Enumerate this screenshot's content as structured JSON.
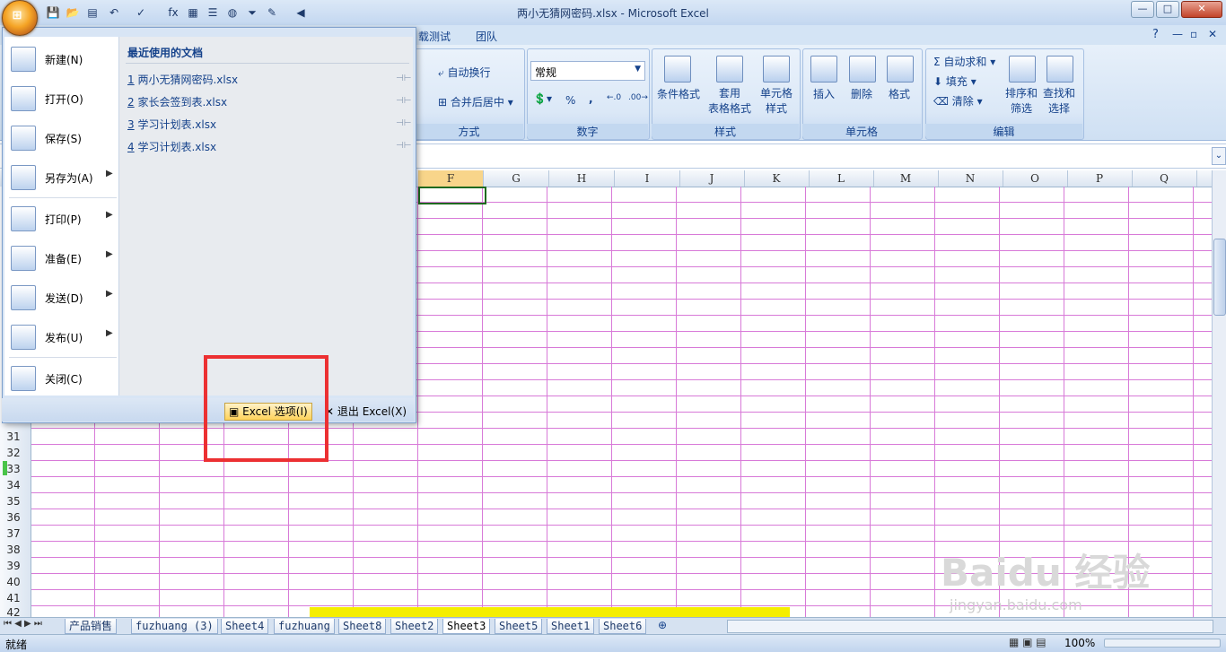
{
  "window": {
    "title": "两小无猜网密码.xlsx - Microsoft Excel",
    "minimize": "—",
    "maximize": "□",
    "close": "✕"
  },
  "ribbon": {
    "tabs": [
      "载测试",
      "团队"
    ],
    "alignment": {
      "wrap_text": "自动换行",
      "merge_center": "合并后居中 ▾",
      "label": "方式"
    },
    "number": {
      "format": "常规",
      "percent": "%",
      "comma": ",",
      "label": "数字"
    },
    "styles": {
      "conditional": "条件格式",
      "table_format": "套用\n表格格式",
      "cell_styles": "单元格\n样式",
      "label": "样式"
    },
    "cells": {
      "insert": "插入",
      "delete": "删除",
      "format": "格式",
      "label": "单元格"
    },
    "editing": {
      "autosum": "自动求和 ▾",
      "fill": "填充 ▾",
      "clear": "清除 ▾",
      "sort": "排序和\n筛选",
      "find": "查找和\n选择",
      "label": "编辑"
    }
  },
  "grid": {
    "columns": [
      "F",
      "G",
      "H",
      "I",
      "J",
      "K",
      "L",
      "M",
      "N",
      "O",
      "P",
      "Q"
    ],
    "visible_rows": [
      "31",
      "32",
      "33",
      "34",
      "35",
      "36",
      "37",
      "38",
      "39",
      "40",
      "41",
      "42"
    ]
  },
  "office_menu": {
    "items": [
      {
        "label": "新建(N)",
        "icon": "new-document-icon",
        "submenu": false
      },
      {
        "label": "打开(O)",
        "icon": "open-folder-icon",
        "submenu": false
      },
      {
        "label": "保存(S)",
        "icon": "save-disk-icon",
        "submenu": false
      },
      {
        "label": "另存为(A)",
        "icon": "save-as-icon",
        "submenu": true
      },
      {
        "label": "打印(P)",
        "icon": "printer-icon",
        "submenu": true
      },
      {
        "label": "准备(E)",
        "icon": "prepare-pen-icon",
        "submenu": true
      },
      {
        "label": "发送(D)",
        "icon": "send-icon",
        "submenu": true
      },
      {
        "label": "发布(U)",
        "icon": "publish-icon",
        "submenu": true
      },
      {
        "label": "关闭(C)",
        "icon": "close-folder-icon",
        "submenu": false
      }
    ],
    "recent_title": "最近使用的文档",
    "recent_docs": [
      {
        "index": "1",
        "name": "两小无猜网密码.xlsx"
      },
      {
        "index": "2",
        "name": "家长会签到表.xlsx"
      },
      {
        "index": "3",
        "name": "学习计划表.xlsx"
      },
      {
        "index": "4",
        "name": "学习计划表.xlsx"
      }
    ],
    "options_button": "Excel 选项(I)",
    "exit_button": "退出 Excel(X)"
  },
  "sheets": [
    "产品销售",
    "fuzhuang (3)",
    "Sheet4",
    "fuzhuang",
    "Sheet8",
    "Sheet2",
    "Sheet3",
    "Sheet5",
    "Sheet1",
    "Sheet6"
  ],
  "active_sheet": "Sheet3",
  "status": {
    "ready": "就绪",
    "zoom": "100%"
  },
  "watermark": {
    "main": "Baidu 经验",
    "sub": "jingyan.baidu.com"
  },
  "colors": {
    "annotation": "#ec3032",
    "highlight_bar": "#f5ee00",
    "gridline": "#d87ad8"
  }
}
